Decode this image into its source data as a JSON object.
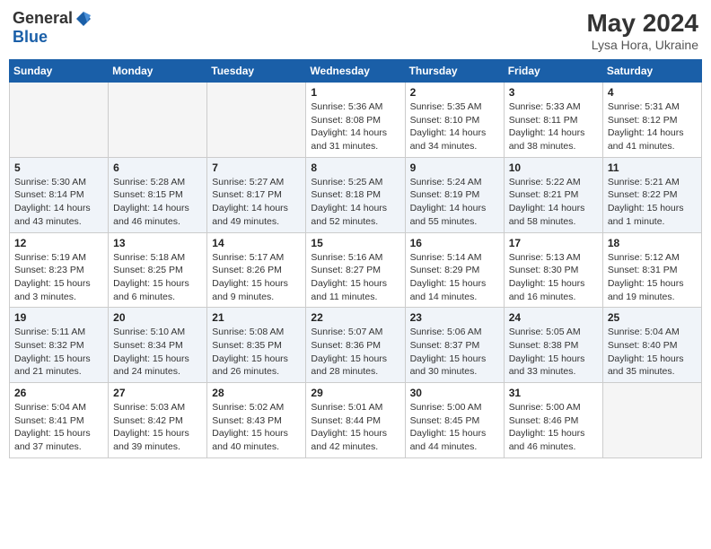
{
  "header": {
    "logo_general": "General",
    "logo_blue": "Blue",
    "title": "May 2024",
    "subtitle": "Lysa Hora, Ukraine"
  },
  "weekdays": [
    "Sunday",
    "Monday",
    "Tuesday",
    "Wednesday",
    "Thursday",
    "Friday",
    "Saturday"
  ],
  "weeks": [
    [
      {
        "day": "",
        "info": ""
      },
      {
        "day": "",
        "info": ""
      },
      {
        "day": "",
        "info": ""
      },
      {
        "day": "1",
        "info": "Sunrise: 5:36 AM\nSunset: 8:08 PM\nDaylight: 14 hours\nand 31 minutes."
      },
      {
        "day": "2",
        "info": "Sunrise: 5:35 AM\nSunset: 8:10 PM\nDaylight: 14 hours\nand 34 minutes."
      },
      {
        "day": "3",
        "info": "Sunrise: 5:33 AM\nSunset: 8:11 PM\nDaylight: 14 hours\nand 38 minutes."
      },
      {
        "day": "4",
        "info": "Sunrise: 5:31 AM\nSunset: 8:12 PM\nDaylight: 14 hours\nand 41 minutes."
      }
    ],
    [
      {
        "day": "5",
        "info": "Sunrise: 5:30 AM\nSunset: 8:14 PM\nDaylight: 14 hours\nand 43 minutes."
      },
      {
        "day": "6",
        "info": "Sunrise: 5:28 AM\nSunset: 8:15 PM\nDaylight: 14 hours\nand 46 minutes."
      },
      {
        "day": "7",
        "info": "Sunrise: 5:27 AM\nSunset: 8:17 PM\nDaylight: 14 hours\nand 49 minutes."
      },
      {
        "day": "8",
        "info": "Sunrise: 5:25 AM\nSunset: 8:18 PM\nDaylight: 14 hours\nand 52 minutes."
      },
      {
        "day": "9",
        "info": "Sunrise: 5:24 AM\nSunset: 8:19 PM\nDaylight: 14 hours\nand 55 minutes."
      },
      {
        "day": "10",
        "info": "Sunrise: 5:22 AM\nSunset: 8:21 PM\nDaylight: 14 hours\nand 58 minutes."
      },
      {
        "day": "11",
        "info": "Sunrise: 5:21 AM\nSunset: 8:22 PM\nDaylight: 15 hours\nand 1 minute."
      }
    ],
    [
      {
        "day": "12",
        "info": "Sunrise: 5:19 AM\nSunset: 8:23 PM\nDaylight: 15 hours\nand 3 minutes."
      },
      {
        "day": "13",
        "info": "Sunrise: 5:18 AM\nSunset: 8:25 PM\nDaylight: 15 hours\nand 6 minutes."
      },
      {
        "day": "14",
        "info": "Sunrise: 5:17 AM\nSunset: 8:26 PM\nDaylight: 15 hours\nand 9 minutes."
      },
      {
        "day": "15",
        "info": "Sunrise: 5:16 AM\nSunset: 8:27 PM\nDaylight: 15 hours\nand 11 minutes."
      },
      {
        "day": "16",
        "info": "Sunrise: 5:14 AM\nSunset: 8:29 PM\nDaylight: 15 hours\nand 14 minutes."
      },
      {
        "day": "17",
        "info": "Sunrise: 5:13 AM\nSunset: 8:30 PM\nDaylight: 15 hours\nand 16 minutes."
      },
      {
        "day": "18",
        "info": "Sunrise: 5:12 AM\nSunset: 8:31 PM\nDaylight: 15 hours\nand 19 minutes."
      }
    ],
    [
      {
        "day": "19",
        "info": "Sunrise: 5:11 AM\nSunset: 8:32 PM\nDaylight: 15 hours\nand 21 minutes."
      },
      {
        "day": "20",
        "info": "Sunrise: 5:10 AM\nSunset: 8:34 PM\nDaylight: 15 hours\nand 24 minutes."
      },
      {
        "day": "21",
        "info": "Sunrise: 5:08 AM\nSunset: 8:35 PM\nDaylight: 15 hours\nand 26 minutes."
      },
      {
        "day": "22",
        "info": "Sunrise: 5:07 AM\nSunset: 8:36 PM\nDaylight: 15 hours\nand 28 minutes."
      },
      {
        "day": "23",
        "info": "Sunrise: 5:06 AM\nSunset: 8:37 PM\nDaylight: 15 hours\nand 30 minutes."
      },
      {
        "day": "24",
        "info": "Sunrise: 5:05 AM\nSunset: 8:38 PM\nDaylight: 15 hours\nand 33 minutes."
      },
      {
        "day": "25",
        "info": "Sunrise: 5:04 AM\nSunset: 8:40 PM\nDaylight: 15 hours\nand 35 minutes."
      }
    ],
    [
      {
        "day": "26",
        "info": "Sunrise: 5:04 AM\nSunset: 8:41 PM\nDaylight: 15 hours\nand 37 minutes."
      },
      {
        "day": "27",
        "info": "Sunrise: 5:03 AM\nSunset: 8:42 PM\nDaylight: 15 hours\nand 39 minutes."
      },
      {
        "day": "28",
        "info": "Sunrise: 5:02 AM\nSunset: 8:43 PM\nDaylight: 15 hours\nand 40 minutes."
      },
      {
        "day": "29",
        "info": "Sunrise: 5:01 AM\nSunset: 8:44 PM\nDaylight: 15 hours\nand 42 minutes."
      },
      {
        "day": "30",
        "info": "Sunrise: 5:00 AM\nSunset: 8:45 PM\nDaylight: 15 hours\nand 44 minutes."
      },
      {
        "day": "31",
        "info": "Sunrise: 5:00 AM\nSunset: 8:46 PM\nDaylight: 15 hours\nand 46 minutes."
      },
      {
        "day": "",
        "info": ""
      }
    ]
  ]
}
